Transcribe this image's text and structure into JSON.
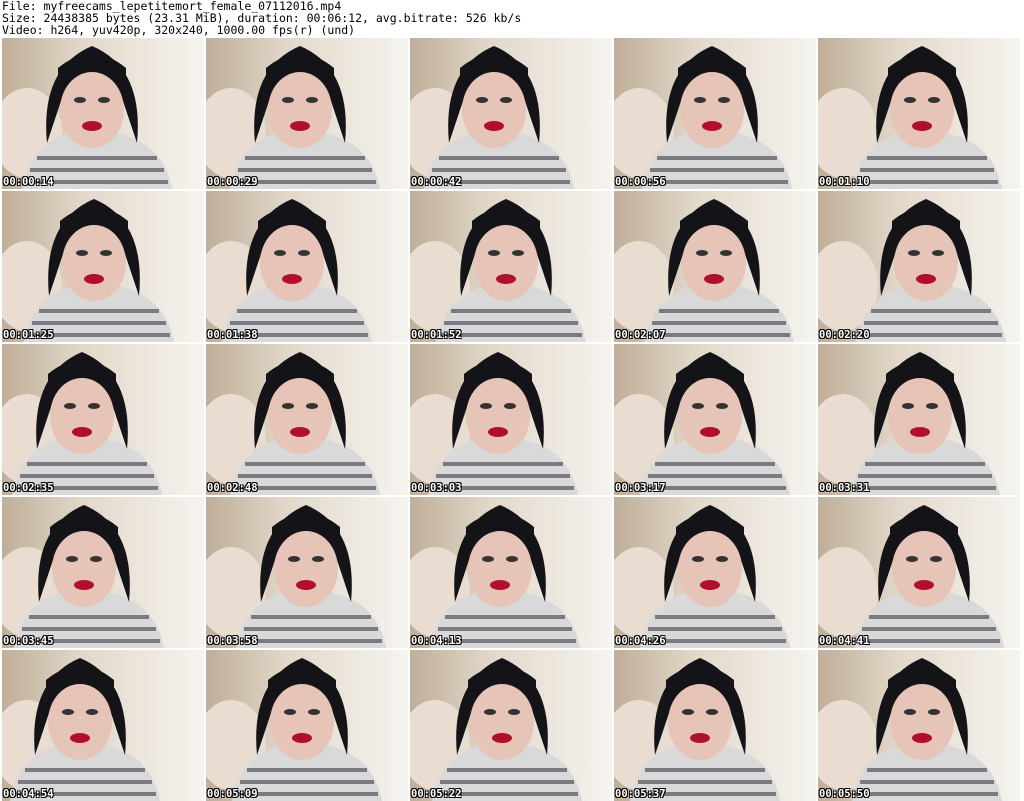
{
  "header": {
    "line1": "File: myfreecams_lepetitemort_female_07112016.mp4",
    "line2": "Size: 24438385 bytes (23.31 MiB), duration: 00:06:12, avg.bitrate: 526 kb/s",
    "line3": "Video: h264, yuv420p, 320x240, 1000.00 fps(r) (und)"
  },
  "thumbnails": [
    {
      "time": "00:00:14"
    },
    {
      "time": "00:00:29"
    },
    {
      "time": "00:00:42"
    },
    {
      "time": "00:00:56"
    },
    {
      "time": "00:01:10"
    },
    {
      "time": "00:01:25"
    },
    {
      "time": "00:01:38"
    },
    {
      "time": "00:01:52"
    },
    {
      "time": "00:02:07"
    },
    {
      "time": "00:02:20"
    },
    {
      "time": "00:02:35"
    },
    {
      "time": "00:02:48"
    },
    {
      "time": "00:03:03"
    },
    {
      "time": "00:03:17"
    },
    {
      "time": "00:03:31"
    },
    {
      "time": "00:03:45"
    },
    {
      "time": "00:03:58"
    },
    {
      "time": "00:04:13"
    },
    {
      "time": "00:04:26"
    },
    {
      "time": "00:04:41"
    },
    {
      "time": "00:04:54"
    },
    {
      "time": "00:05:09"
    },
    {
      "time": "00:05:22"
    },
    {
      "time": "00:05:37"
    },
    {
      "time": "00:05:50"
    }
  ],
  "colors": {
    "hair": "#141418",
    "skin": "#e6c4b8",
    "lips": "#b0102a",
    "shirt_light": "#d9d9d9",
    "shirt_dark": "#7a7a80",
    "pillow": "#e8ddd0",
    "timestamp_text": "#ffffff"
  }
}
